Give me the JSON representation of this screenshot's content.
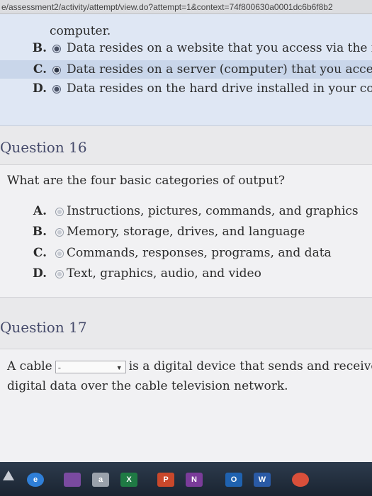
{
  "browser": {
    "url": "e/assessment2/activity/attempt/view.do?attempt=1&context=74f800630a0001dc6b6f8b2"
  },
  "prev_question": {
    "continued_text": "computer.",
    "options": [
      {
        "letter": "B.",
        "text": "Data resides on a website that you access via the in"
      },
      {
        "letter": "C.",
        "text": "Data resides on a server (computer) that you access"
      },
      {
        "letter": "D.",
        "text": "Data resides on the hard drive installed in your com"
      }
    ],
    "selected": "C."
  },
  "question16": {
    "heading": "Question 16",
    "prompt": "What are the four basic categories of output?",
    "options": [
      {
        "letter": "A.",
        "text": "Instructions, pictures, commands, and graphics"
      },
      {
        "letter": "B.",
        "text": "Memory, storage, drives, and language"
      },
      {
        "letter": "C.",
        "text": "Commands, responses, programs, and data"
      },
      {
        "letter": "D.",
        "text": "Text, graphics, audio, and video"
      }
    ]
  },
  "question17": {
    "heading": "Question 17",
    "line1_before": "A cable",
    "select_value": "-",
    "line1_after": "is a digital device that sends and receives",
    "line2": "digital data over the cable television network."
  },
  "taskbar": {
    "icons": [
      {
        "name": "ie-icon",
        "label": "e",
        "color": "#2f7fd8"
      },
      {
        "name": "paint-icon",
        "label": "",
        "color": "#7a4aa0"
      },
      {
        "name": "amazon-icon",
        "label": "a",
        "color": "#9aa1ab"
      },
      {
        "name": "excel-icon",
        "label": "X",
        "color": "#1f7a44"
      },
      {
        "name": "powerpoint-icon",
        "label": "P",
        "color": "#c9482b"
      },
      {
        "name": "onenote-icon",
        "label": "N",
        "color": "#7b3c9a"
      },
      {
        "name": "outlook-icon",
        "label": "O",
        "color": "#1f62b0"
      },
      {
        "name": "word-icon",
        "label": "W",
        "color": "#2a5aa6"
      },
      {
        "name": "chrome-icon",
        "label": "",
        "color": "#d94f3a"
      }
    ]
  }
}
